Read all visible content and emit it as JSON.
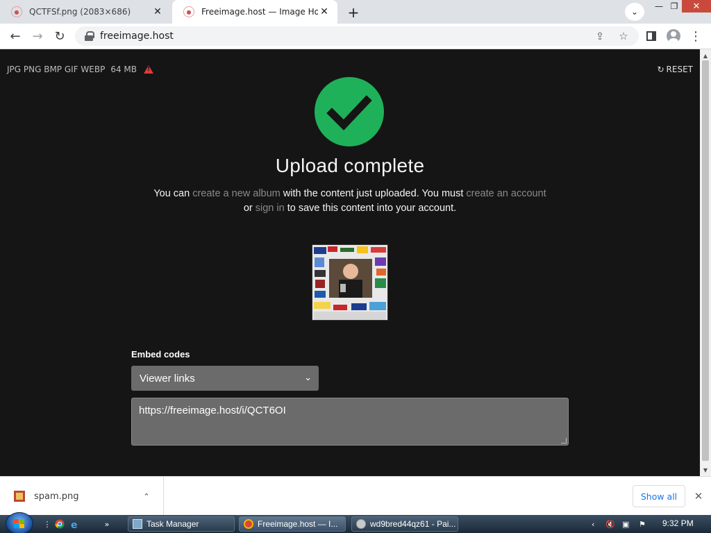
{
  "browser": {
    "tabs": [
      {
        "title": "QCTFSf.png (2083×686)",
        "active": false
      },
      {
        "title": "Freeimage.host — Image Hosting",
        "active": true
      }
    ],
    "new_tab": "+",
    "tab_search_icon": "chevron-down-icon",
    "window_controls": {
      "minimize": "—",
      "maximize": "❐",
      "close": "✕"
    },
    "url": "freeimage.host"
  },
  "page": {
    "formats": "JPG PNG BMP GIF WEBP",
    "max_size": "64 MB",
    "reset": "RESET",
    "headline": "Upload complete",
    "message": {
      "p1": "You can ",
      "link_album": "create a new album",
      "p2": " with the content just uploaded. You must ",
      "link_account": "create an account",
      "p3": "or ",
      "link_signin": "sign in",
      "p4": " to save this content into your account."
    },
    "embed_label": "Embed codes",
    "embed_select": "Viewer links",
    "embed_value": "https://freeimage.host/i/QCT6OI",
    "colors": {
      "accent_check": "#1fb159",
      "page_bg": "#151515",
      "link_gray": "#8a8a8a"
    }
  },
  "downloads": {
    "file": "spam.png",
    "show_all": "Show all"
  },
  "taskbar": {
    "items": [
      {
        "label": "Task Manager",
        "active": false
      },
      {
        "label": "Freeimage.host — I...",
        "active": true
      },
      {
        "label": "wd9bred44qz61 - Pai...",
        "active": false
      }
    ],
    "clock": "9:32 PM"
  }
}
